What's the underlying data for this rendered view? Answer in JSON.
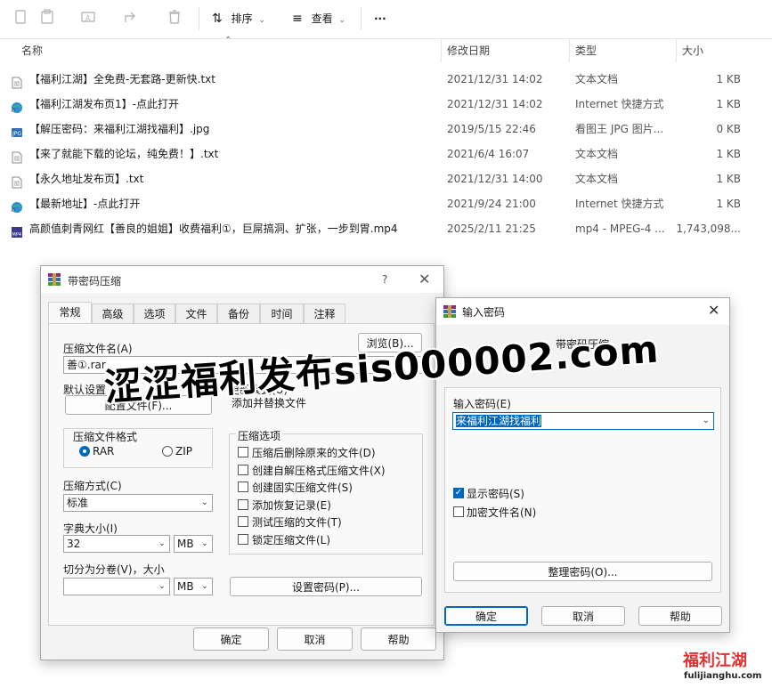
{
  "toolbar": {
    "sort_label": "排序",
    "view_label": "查看",
    "more_label": "···"
  },
  "columns": {
    "name": "名称",
    "date": "修改日期",
    "type": "类型",
    "size": "大小"
  },
  "files": [
    {
      "icon": "txt-file-icon",
      "name": "【福利江湖】全免费-无套路-更新快.txt",
      "date": "2021/12/31 14:02",
      "type": "文本文档",
      "size": "1 KB"
    },
    {
      "icon": "internet-shortcut-icon",
      "name": "【福利江湖发布页1】-点此打开",
      "date": "2021/12/31 14:02",
      "type": "Internet 快捷方式",
      "size": "1 KB"
    },
    {
      "icon": "jpg-file-icon",
      "name": "【解压密码：来福利江湖找福利】.jpg",
      "date": "2019/5/15 22:46",
      "type": "看图王 JPG 图片...",
      "size": "0 KB"
    },
    {
      "icon": "txt-file-icon",
      "name": "【来了就能下载的论坛，纯免费！】.txt",
      "date": "2021/6/4 16:07",
      "type": "文本文档",
      "size": "1 KB"
    },
    {
      "icon": "txt-file-icon",
      "name": "【永久地址发布页】.txt",
      "date": "2021/12/31 14:00",
      "type": "文本文档",
      "size": "1 KB"
    },
    {
      "icon": "internet-shortcut-icon",
      "name": "【最新地址】-点此打开",
      "date": "2021/9/24 21:00",
      "type": "Internet 快捷方式",
      "size": "1 KB"
    },
    {
      "icon": "mp4-file-icon",
      "name": "高颜值刺青网红【善良的姐姐】收费福利①，巨屌搞洞、扩张，一步到胃.mp4",
      "date": "2025/2/11 21:25",
      "type": "mp4 - MPEG-4 ...",
      "size": "1,743,098..."
    }
  ],
  "archive_dialog": {
    "title": "带密码压缩",
    "help_glyph": "?",
    "tabs": [
      "常规",
      "高级",
      "选项",
      "文件",
      "备份",
      "时间",
      "注释"
    ],
    "archive_name_label": "压缩文件名(A)",
    "browse_label": "浏览(B)...",
    "archive_name_value": "善①.rar",
    "default_settings_label": "默认设置",
    "profiles_label": "配置文件(F)...",
    "update_mode_label": "更新模式(U)",
    "update_mode_value": "添加并替换文件",
    "format_label": "压缩文件格式",
    "format_rar": "RAR",
    "format_zip": "ZIP",
    "options_label": "压缩选项",
    "options": [
      "压缩后删除原来的文件(D)",
      "创建自解压格式压缩文件(X)",
      "创建固实压缩文件(S)",
      "添加恢复记录(E)",
      "测试压缩的文件(T)",
      "锁定压缩文件(L)"
    ],
    "method_label": "压缩方式(C)",
    "method_value": "标准",
    "dict_label": "字典大小(I)",
    "dict_value": "32",
    "dict_unit": "MB",
    "split_label": "切分为分卷(V)，大小",
    "split_value": "",
    "split_unit": "MB",
    "set_password_label": "设置密码(P)...",
    "ok_label": "确定",
    "cancel_label": "取消",
    "help_label": "帮助"
  },
  "password_dialog": {
    "title": "输入密码",
    "subtitle": "带密码压缩",
    "enter_label": "输入密码(E)",
    "password_value": "来福利江湖找福利",
    "show_password_label": "显示密码(S)",
    "show_password_checked": true,
    "encrypt_names_label": "加密文件名(N)",
    "encrypt_names_checked": false,
    "organize_label": "整理密码(O)...",
    "ok_label": "确定",
    "cancel_label": "取消",
    "help_label": "帮助"
  },
  "watermark": {
    "text": "涩涩福利发布sis000002.com"
  },
  "logo": {
    "cn": "福利江湖",
    "url": "fulijianghu.com"
  },
  "colors": {
    "accent": "#0067c0",
    "logo_red": "#e03030"
  }
}
